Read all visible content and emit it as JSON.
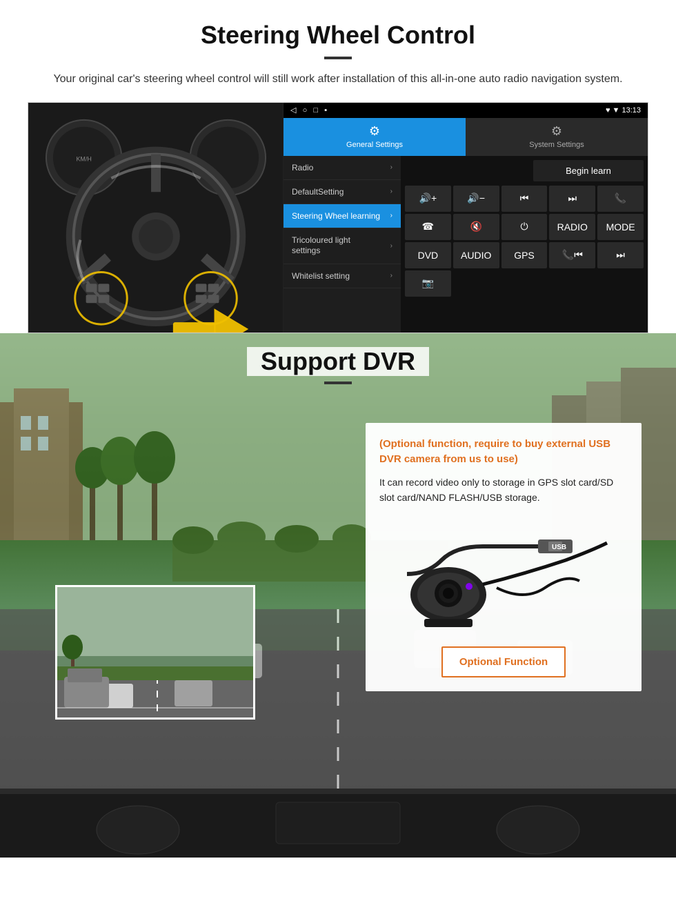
{
  "page": {
    "section1": {
      "title": "Steering Wheel Control",
      "subtitle": "Your original car's steering wheel control will still work after installation of this all-in-one auto radio navigation system.",
      "android_ui": {
        "status_bar": {
          "left_icons": "◁  ○  □  ▪",
          "right": "♥ ▼ 13:13"
        },
        "tab_active": {
          "icon": "⚙",
          "label": "General Settings"
        },
        "tab_inactive": {
          "icon": "⚙",
          "label": "System Settings"
        },
        "menu_items": [
          {
            "label": "Radio",
            "active": false
          },
          {
            "label": "DefaultSetting",
            "active": false
          },
          {
            "label": "Steering Wheel learning",
            "active": true
          },
          {
            "label": "Tricoloured light settings",
            "active": false
          },
          {
            "label": "Whitelist setting",
            "active": false
          }
        ],
        "begin_learn_label": "Begin learn",
        "control_buttons": [
          "🔊+",
          "🔊-",
          "⏮",
          "⏭",
          "📞",
          "📞",
          "🔇",
          "⏻",
          "RADIO",
          "MODE",
          "DVD",
          "AUDIO",
          "GPS",
          "📞⏮",
          "⏭"
        ]
      }
    },
    "section2": {
      "title": "Support DVR",
      "optional_text": "(Optional function, require to buy external USB DVR camera from us to use)",
      "desc_text": "It can record video only to storage in GPS slot card/SD slot card/NAND FLASH/USB storage.",
      "optional_function_label": "Optional Function"
    }
  }
}
